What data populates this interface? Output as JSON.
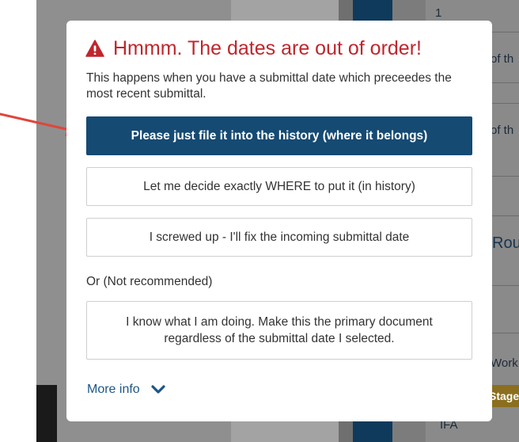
{
  "background": {
    "row_number": "1",
    "fragment_1": "of th",
    "fragment_2": "of th",
    "fragment_3": "Rou",
    "fragment_4": "Work",
    "fragment_5": "IFA",
    "tag_label": "Stage"
  },
  "dialog": {
    "title": "Hmmm. The dates are out of order!",
    "description": "This happens when you have a submittal date which preceedes the most recent submittal.",
    "option_file_history": "Please just file it into the history (where it belongs)",
    "option_choose_location": "Let me decide exactly WHERE to put it (in history)",
    "option_fix_date": "I screwed up - I'll fix the incoming submittal date",
    "or_label": "Or (Not recommended)",
    "option_make_primary": "I know what I am doing. Make this the primary document regardless of the submittal date I selected.",
    "more_info": "More info"
  },
  "colors": {
    "title_red": "#c0262c",
    "primary_blue": "#154a73",
    "link_blue": "#1e5686",
    "annotation_red": "#e0453c"
  },
  "icons": {
    "title_icon": "warning-triangle-icon",
    "more_info_icon": "chevron-down-icon",
    "annotation": "red-arrow-icon"
  }
}
